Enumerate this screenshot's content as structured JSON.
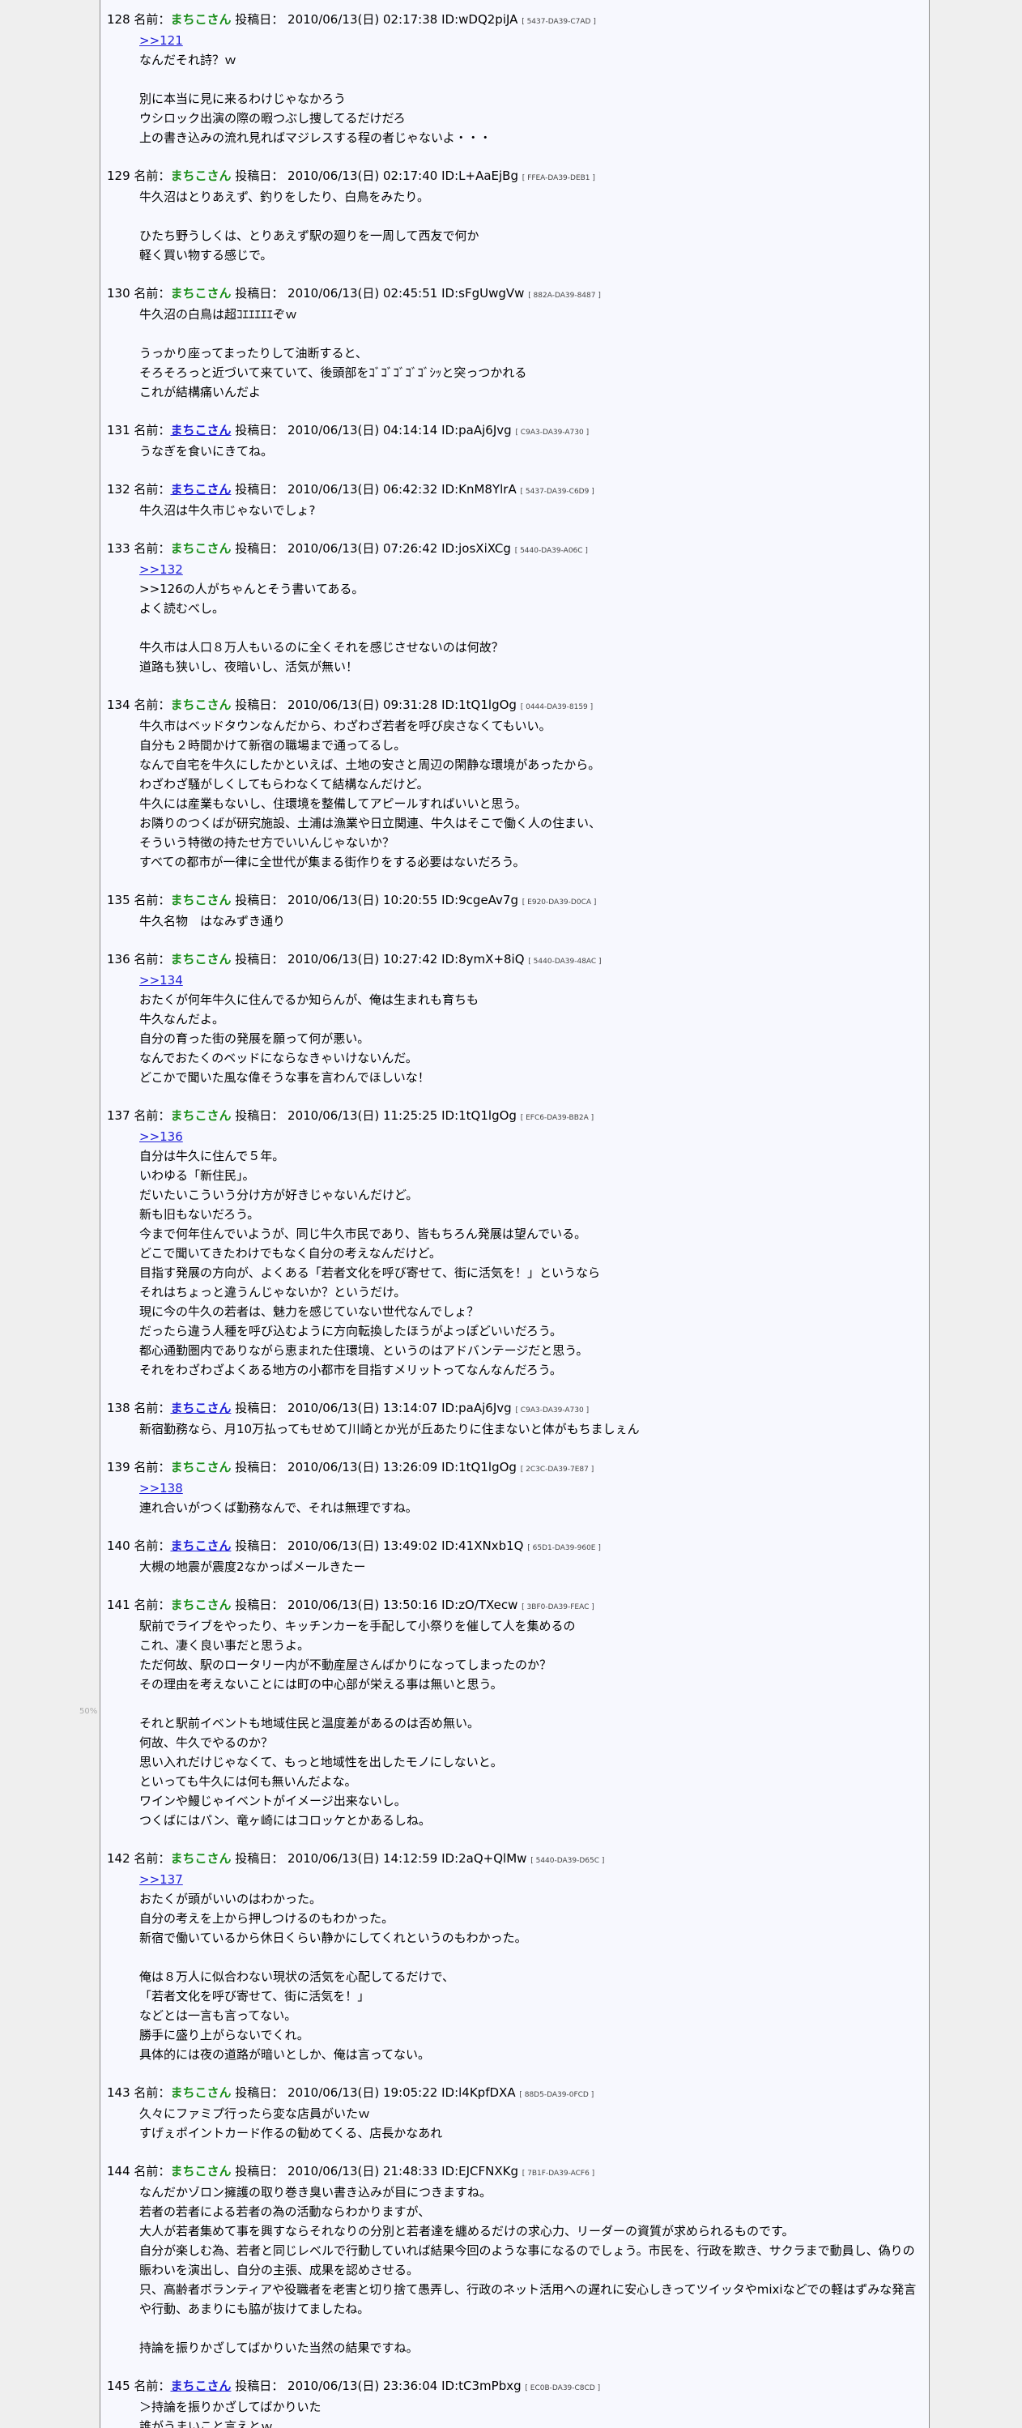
{
  "labels": {
    "name": "名前：",
    "date": "投稿日："
  },
  "side_note": "50%",
  "posts": [
    {
      "no": "128",
      "name": "まちこさん",
      "email": false,
      "date": "2010/06/13(日) 02:17:38",
      "id": "ID:wDQ2piJA",
      "sig": "[ 5437-DA39-C7AD ]",
      "body": [
        ">>121",
        "なんだそれ詩？ｗ",
        "",
        "別に本当に見に来るわけじゃなかろう",
        "ウシロック出演の際の暇つぶし捜してるだけだろ",
        "上の書き込みの流れ見ればマジレスする程の者じゃないよ・・・"
      ]
    },
    {
      "no": "129",
      "name": "まちこさん",
      "email": false,
      "date": "2010/06/13(日) 02:17:40",
      "id": "ID:L+AaEjBg",
      "sig": "[ FFEA-DA39-DEB1 ]",
      "body": [
        "牛久沼はとりあえず、釣りをしたり、白鳥をみたり。",
        "",
        "ひたち野うしくは、とりあえず駅の廻りを一周して西友で何か",
        "軽く買い物する感じで。"
      ]
    },
    {
      "no": "130",
      "name": "まちこさん",
      "email": false,
      "date": "2010/06/13(日) 02:45:51",
      "id": "ID:sFgUwgVw",
      "sig": "[ 882A-DA39-8487 ]",
      "body": [
        "牛久沼の白鳥は超ｺｴｴｴｴｴぞｗ",
        "",
        "うっかり座ってまったりして油断すると、",
        "そろそろっと近づいて来ていて、後頭部をｺﾞｺﾞｺﾞｺﾞｺﾞｼｯと突っつかれる",
        "これが結構痛いんだよ"
      ]
    },
    {
      "no": "131",
      "name": "まちこさん",
      "email": true,
      "date": "2010/06/13(日) 04:14:14",
      "id": "ID:paAj6Jvg",
      "sig": "[ C9A3-DA39-A730 ]",
      "body": [
        "うなぎを食いにきてね。"
      ]
    },
    {
      "no": "132",
      "name": "まちこさん",
      "email": true,
      "date": "2010/06/13(日) 06:42:32",
      "id": "ID:KnM8YlrA",
      "sig": "[ 5437-DA39-C6D9 ]",
      "body": [
        "牛久沼は牛久市じゃないでしょ?"
      ]
    },
    {
      "no": "133",
      "name": "まちこさん",
      "email": false,
      "date": "2010/06/13(日) 07:26:42",
      "id": "ID:josXiXCg",
      "sig": "[ 5440-DA39-A06C ]",
      "body": [
        ">>132",
        ">>126の人がちゃんとそう書いてある。",
        "よく読むべし。",
        "",
        "牛久市は人口８万人もいるのに全くそれを感じさせないのは何故？",
        "道路も狭いし、夜暗いし、活気が無い！"
      ]
    },
    {
      "no": "134",
      "name": "まちこさん",
      "email": false,
      "date": "2010/06/13(日) 09:31:28",
      "id": "ID:1tQ1lgOg",
      "sig": "[ 0444-DA39-8159 ]",
      "body": [
        "牛久市はベッドタウンなんだから、わざわざ若者を呼び戻さなくてもいい。",
        "自分も２時間かけて新宿の職場まで通ってるし。",
        "なんで自宅を牛久にしたかといえば、土地の安さと周辺の閑静な環境があったから。",
        "わざわざ騒がしくしてもらわなくて結構なんだけど。",
        "牛久には産業もないし、住環境を整備してアピールすればいいと思う。",
        "お隣りのつくばが研究施設、土浦は漁業や日立関連、牛久はそこで働く人の住まい、",
        "そういう特徴の持たせ方でいいんじゃないか？",
        "すべての都市が一律に全世代が集まる街作りをする必要はないだろう。"
      ]
    },
    {
      "no": "135",
      "name": "まちこさん",
      "email": false,
      "date": "2010/06/13(日) 10:20:55",
      "id": "ID:9cgeAv7g",
      "sig": "[ E920-DA39-D0CA ]",
      "body": [
        "牛久名物　はなみずき通り"
      ]
    },
    {
      "no": "136",
      "name": "まちこさん",
      "email": false,
      "date": "2010/06/13(日) 10:27:42",
      "id": "ID:8ymX+8iQ",
      "sig": "[ 5440-DA39-48AC ]",
      "body": [
        ">>134",
        "おたくが何年牛久に住んでるか知らんが、俺は生まれも育ちも",
        "牛久なんだよ。",
        "自分の育った街の発展を願って何が悪い。",
        "なんでおたくのベッドにならなきゃいけないんだ。",
        "どこかで聞いた風な偉そうな事を言わんでほしいな！"
      ]
    },
    {
      "no": "137",
      "name": "まちこさん",
      "email": false,
      "date": "2010/06/13(日) 11:25:25",
      "id": "ID:1tQ1lgOg",
      "sig": "[ EFC6-DA39-BB2A ]",
      "body": [
        ">>136",
        "自分は牛久に住んで５年。",
        "いわゆる「新住民」。",
        "だいたいこういう分け方が好きじゃないんだけど。",
        "新も旧もないだろう。",
        "今まで何年住んでいようが、同じ牛久市民であり、皆もちろん発展は望んでいる。",
        "どこで聞いてきたわけでもなく自分の考えなんだけど。",
        "目指す発展の方向が、よくある「若者文化を呼び寄せて、街に活気を！」というなら",
        "それはちょっと違うんじゃないか？というだけ。",
        "現に今の牛久の若者は、魅力を感じていない世代なんでしょ？",
        "だったら違う人種を呼び込むように方向転換したほうがよっぽどいいだろう。",
        "都心通勤圏内でありながら恵まれた住環境、というのはアドバンテージだと思う。",
        "それをわざわざよくある地方の小都市を目指すメリットってなんなんだろう。"
      ]
    },
    {
      "no": "138",
      "name": "まちこさん",
      "email": true,
      "date": "2010/06/13(日) 13:14:07",
      "id": "ID:paAj6Jvg",
      "sig": "[ C9A3-DA39-A730 ]",
      "body": [
        "新宿勤務なら、月10万払ってもせめて川崎とか光が丘あたりに住まないと体がもちましぇん"
      ]
    },
    {
      "no": "139",
      "name": "まちこさん",
      "email": false,
      "date": "2010/06/13(日) 13:26:09",
      "id": "ID:1tQ1lgOg",
      "sig": "[ 2C3C-DA39-7E87 ]",
      "body": [
        ">>138",
        "連れ合いがつくば勤務なんで、それは無理ですね。"
      ]
    },
    {
      "no": "140",
      "name": "まちこさん",
      "email": true,
      "date": "2010/06/13(日) 13:49:02",
      "id": "ID:41XNxb1Q",
      "sig": "[ 65D1-DA39-960E ]",
      "body": [
        "大槻の地震が震度2なかっぱメールきたー"
      ]
    },
    {
      "no": "141",
      "name": "まちこさん",
      "email": false,
      "date": "2010/06/13(日) 13:50:16",
      "id": "ID:zO/TXecw",
      "sig": "[ 3BF0-DA39-FEAC ]",
      "body": [
        "駅前でライブをやったり、キッチンカーを手配して小祭りを催して人を集めるの",
        "これ、凄く良い事だと思うよ。",
        "ただ何故、駅のロータリー内が不動産屋さんばかりになってしまったのか？",
        "その理由を考えないことには町の中心部が栄える事は無いと思う。",
        "",
        "それと駅前イベントも地域住民と温度差があるのは否め無い。",
        "何故、牛久でやるのか？",
        "思い入れだけじゃなくて、もっと地域性を出したモノにしないと。",
        "といっても牛久には何も無いんだよな。",
        "ワインや鰻じゃイベントがイメージ出来ないし。",
        "つくばにはパン、竜ヶ崎にはコロッケとかあるしね。"
      ]
    },
    {
      "no": "142",
      "name": "まちこさん",
      "email": false,
      "date": "2010/06/13(日) 14:12:59",
      "id": "ID:2aQ+QlMw",
      "sig": "[ 5440-DA39-D65C ]",
      "body": [
        ">>137",
        "おたくが頭がいいのはわかった。",
        "自分の考えを上から押しつけるのもわかった。",
        "新宿で働いているから休日くらい静かにしてくれというのもわかった。",
        "",
        "俺は８万人に似合わない現状の活気を心配してるだけで、",
        "「若者文化を呼び寄せて、街に活気を！」",
        "などとは一言も言ってない。",
        "勝手に盛り上がらないでくれ。",
        "具体的には夜の道路が暗いとしか、俺は言ってない。"
      ]
    },
    {
      "no": "143",
      "name": "まちこさん",
      "email": false,
      "date": "2010/06/13(日) 19:05:22",
      "id": "ID:l4KpfDXA",
      "sig": "[ 88D5-DA39-0FCD ]",
      "body": [
        "久々にファミプ行ったら変な店員がいたｗ",
        "すげぇポイントカード作るの勧めてくる、店長かなあれ"
      ]
    },
    {
      "no": "144",
      "name": "まちこさん",
      "email": false,
      "date": "2010/06/13(日) 21:48:33",
      "id": "ID:EJCFNXKg",
      "sig": "[ 7B1F-DA39-ACF6 ]",
      "body": [
        "なんだかゾロン擁護の取り巻き臭い書き込みが目につきますね。",
        "若者の若者による若者の為の活動ならわかりますが、",
        "大人が若者集めて事を興すならそれなりの分別と若者達を纏めるだけの求心力、リーダーの資質が求められるものです。",
        "自分が楽しむ為、若者と同じレベルで行動していれば結果今回のような事になるのでしょう。市民を、行政を欺き、サクラまで動員し、偽りの賑わいを演出し、自分の主張、成果を認めさせる。",
        "只、高齢者ボランティアや役職者を老害と切り捨て愚弄し、行政のネット活用への遅れに安心しきってツイッタやmixiなどでの軽はずみな発言や行動、あまりにも脇が抜けてましたね。",
        "",
        "持論を振りかざしてばかりいた当然の結果ですね。"
      ]
    },
    {
      "no": "145",
      "name": "まちこさん",
      "email": true,
      "date": "2010/06/13(日) 23:36:04",
      "id": "ID:tC3mPbxg",
      "sig": "[ EC0B-DA39-C8CD ]",
      "body": [
        "＞持論を振りかざしてばかりいた",
        "誰がうまいこと言えとｗ"
      ]
    }
  ]
}
